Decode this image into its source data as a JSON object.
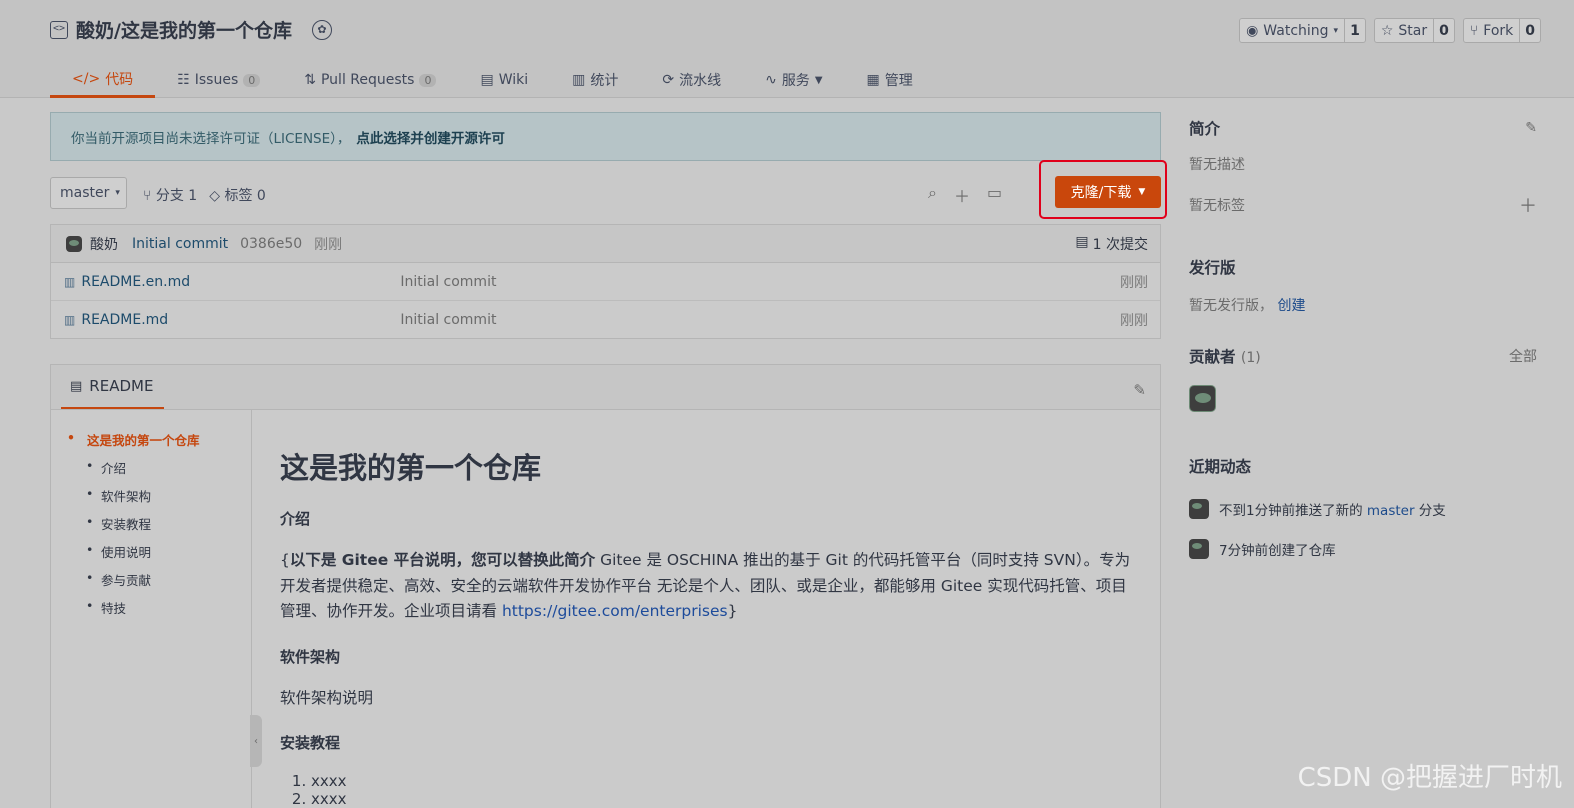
{
  "header": {
    "repo_name": "酸奶/这是我的第一个仓库",
    "watch": {
      "label": "Watching",
      "count": "1"
    },
    "star": {
      "label": "Star",
      "count": "0"
    },
    "fork": {
      "label": "Fork",
      "count": "0"
    }
  },
  "tabs": [
    {
      "label": "代码",
      "icon": "code-icon",
      "active": true
    },
    {
      "label": "Issues",
      "count": "0",
      "icon": "issues-icon"
    },
    {
      "label": "Pull Requests",
      "count": "0",
      "icon": "pr-icon"
    },
    {
      "label": "Wiki",
      "icon": "wiki-icon"
    },
    {
      "label": "统计",
      "icon": "chart-icon"
    },
    {
      "label": "流水线",
      "icon": "pipeline-icon"
    },
    {
      "label": "服务",
      "icon": "service-icon"
    },
    {
      "label": "管理",
      "icon": "manage-icon"
    }
  ],
  "notice": {
    "text": "你当前开源项目尚未选择许可证（LICENSE），",
    "link": "点此选择并创建开源许可"
  },
  "branch_bar": {
    "branch": "master",
    "branches": "分支 1",
    "tags": "标签 0",
    "clone_label": "克隆/下载"
  },
  "commit": {
    "user": "酸奶",
    "message": "Initial commit",
    "sha": "0386e50",
    "time": "刚刚",
    "count": "1 次提交"
  },
  "files": [
    {
      "name": "README.en.md",
      "message": "Initial commit",
      "time": "刚刚"
    },
    {
      "name": "README.md",
      "message": "Initial commit",
      "time": "刚刚"
    }
  ],
  "readme": {
    "tab_label": "README",
    "toc": [
      "这是我的第一个仓库",
      "介绍",
      "软件架构",
      "安装教程",
      "使用说明",
      "参与贡献",
      "特技"
    ],
    "h1": "这是我的第一个仓库",
    "intro_heading": "介绍",
    "intro_bold": "以下是 Gitee 平台说明，您可以替换此简介",
    "intro_text": " Gitee 是 OSCHINA 推出的基于 Git 的代码托管平台（同时支持 SVN）。专为开发者提供稳定、高效、安全的云端软件开发协作平台 无论是个人、团队、或是企业，都能够用 Gitee 实现代码托管、项目管理、协作开发。企业项目请看 ",
    "intro_link": "https://gitee.com/enterprises",
    "arch_heading": "软件架构",
    "arch_text": "软件架构说明",
    "install_heading": "安装教程",
    "install_items": [
      "xxxx",
      "xxxx"
    ]
  },
  "sidebar": {
    "intro_title": "简介",
    "no_desc": "暂无描述",
    "no_tags": "暂无标签",
    "release_title": "发行版",
    "no_release": "暂无发行版，",
    "create": "创建",
    "contributors_title": "贡献者",
    "contributors_count": "(1)",
    "all": "全部",
    "activity_title": "近期动态",
    "activity": [
      {
        "pre": "不到1分钟前推送了新的 ",
        "link": "master",
        "post": " 分支"
      },
      {
        "pre": "7分钟前创建了仓库",
        "link": "",
        "post": ""
      }
    ]
  },
  "watermark": "CSDN @把握进厂时机"
}
